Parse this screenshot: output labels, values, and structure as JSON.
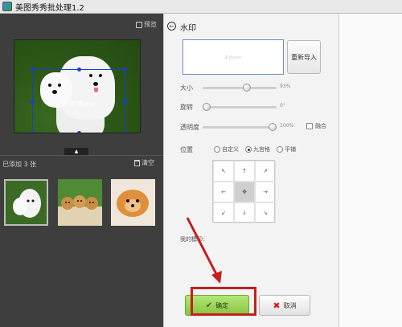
{
  "window": {
    "title": "美图秀秀批处理1.2"
  },
  "left": {
    "preview_label": "预览",
    "watermark_text": "来自year",
    "added_count": "已添加 3 张",
    "clear_label": "清空",
    "collapse_glyph": "▲"
  },
  "right": {
    "title": "水印",
    "back_glyph": "←",
    "wm_preview_text": "来自year",
    "reimport_label": "重新导入",
    "sliders": [
      {
        "label": "大小",
        "value": "93%",
        "level": 0.5
      },
      {
        "label": "旋转",
        "value": "0°",
        "level": 0.0
      },
      {
        "label": "透明度",
        "value": "100%",
        "level": 1.0
      }
    ],
    "merge_label": "融合",
    "position_label": "位置",
    "position_options": [
      "自定义",
      "九宫格",
      "平铺"
    ],
    "position_selected": "九宫格",
    "my_templates_label": "我的模印:",
    "confirm_label": "确定",
    "cancel_label": "取消"
  },
  "colors": {
    "selection": "#1a3cd6",
    "confirm": "#86c43e",
    "highlight": "#c51f1f"
  }
}
